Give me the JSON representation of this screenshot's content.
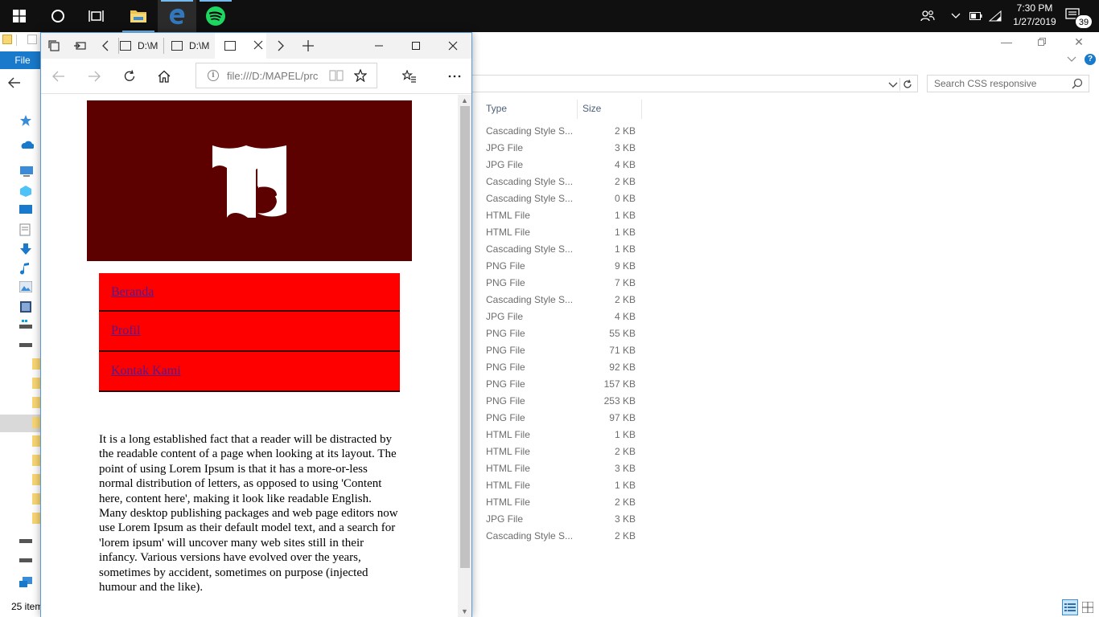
{
  "taskbar": {
    "time": "7:30 PM",
    "date": "1/27/2019",
    "notification_count": "39"
  },
  "explorer": {
    "file_tab": "File",
    "search_placeholder": "Search CSS responsive",
    "columns": {
      "type": "Type",
      "size": "Size"
    },
    "files": [
      {
        "type": "Cascading Style S...",
        "size": "2 KB"
      },
      {
        "type": "JPG File",
        "size": "3 KB"
      },
      {
        "type": "JPG File",
        "size": "4 KB"
      },
      {
        "type": "Cascading Style S...",
        "size": "2 KB"
      },
      {
        "type": "Cascading Style S...",
        "size": "0 KB"
      },
      {
        "type": "HTML File",
        "size": "1 KB"
      },
      {
        "type": "HTML File",
        "size": "1 KB"
      },
      {
        "type": "Cascading Style S...",
        "size": "1 KB"
      },
      {
        "type": "PNG File",
        "size": "9 KB"
      },
      {
        "type": "PNG File",
        "size": "7 KB"
      },
      {
        "type": "Cascading Style S...",
        "size": "2 KB"
      },
      {
        "type": "JPG File",
        "size": "4 KB"
      },
      {
        "type": "PNG File",
        "size": "55 KB"
      },
      {
        "type": "PNG File",
        "size": "71 KB"
      },
      {
        "type": "PNG File",
        "size": "92 KB"
      },
      {
        "type": "PNG File",
        "size": "157 KB"
      },
      {
        "type": "PNG File",
        "size": "253 KB"
      },
      {
        "type": "PNG File",
        "size": "97 KB"
      },
      {
        "type": "HTML File",
        "size": "1 KB"
      },
      {
        "type": "HTML File",
        "size": "2 KB"
      },
      {
        "type": "HTML File",
        "size": "3 KB"
      },
      {
        "type": "HTML File",
        "size": "1 KB"
      },
      {
        "type": "HTML File",
        "size": "2 KB"
      },
      {
        "type": "JPG File",
        "size": "3 KB"
      },
      {
        "type": "Cascading Style S...",
        "size": "2 KB"
      }
    ],
    "status": "25 item"
  },
  "edge": {
    "tabs": [
      {
        "label": "D:\\M"
      },
      {
        "label": "D:\\M"
      },
      {
        "label": ""
      }
    ],
    "url": "file:///D:/MAPEL/prc",
    "page": {
      "menu": [
        {
          "label": "Beranda"
        },
        {
          "label": "Profil"
        },
        {
          "label": "Kontak Kami"
        }
      ],
      "article": "It is a long established fact that a reader will be distracted by the readable content of a page when looking at its layout. The point of using Lorem Ipsum is that it has a more-or-less normal distribution of letters, as opposed to using 'Content here, content here', making it look like readable English. Many desktop publishing packages and web page editors now use Lorem Ipsum as their default model text, and a search for 'lorem ipsum' will uncover many web sites still in their infancy. Various versions have evolved over the years, sometimes by accident, sometimes on purpose (injected humour and the like)."
    }
  },
  "colors": {
    "banner": "#5c0000",
    "menu_bg": "#ff0000",
    "accent": "#1979ca"
  },
  "icons": [
    "windows-start-icon",
    "cortana-icon",
    "task-view-icon",
    "file-explorer-icon",
    "edge-icon",
    "spotify-icon",
    "people-icon",
    "chevron-up-icon",
    "battery-icon",
    "wifi-icon",
    "notification-icon"
  ]
}
